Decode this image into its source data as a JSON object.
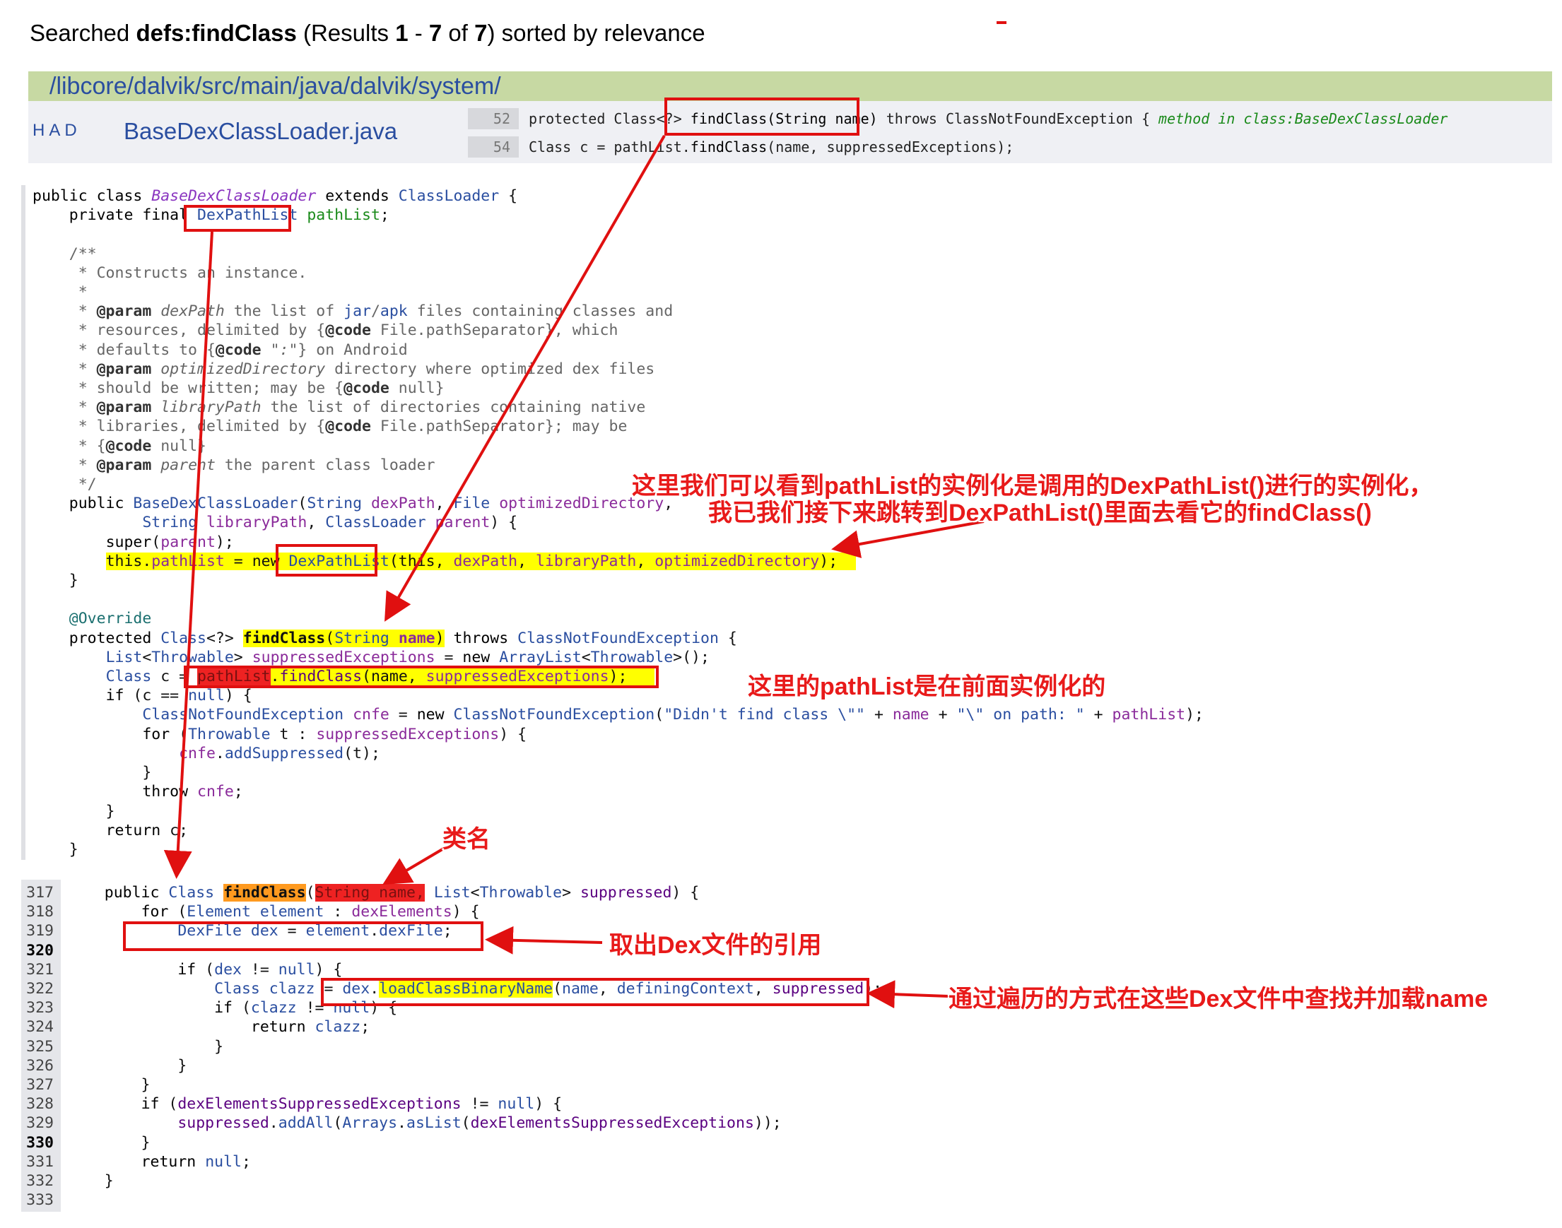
{
  "search_header": {
    "prefix": "Searched ",
    "query": "defs:findClass",
    "results_open": " (Results ",
    "first": "1",
    "dash": " - ",
    "last": "7",
    "of": " of ",
    "total": "7",
    "suffix": ") sorted by relevance"
  },
  "path_bar": {
    "path": "/libcore/dalvik/src/main/java/dalvik/system/"
  },
  "result": {
    "file_actions": "HAD",
    "file_name": "BaseDexClassLoader.java",
    "lines": [
      {
        "num": "52",
        "pre": "protected Class<?> ",
        "hit": "findClass(String name)",
        "post": " throws ClassNotFoundException { ",
        "note": "method in class:BaseDexClassLoader"
      },
      {
        "num": "54",
        "pre": "Class c = pathList.",
        "hit": "findClass",
        "post": "(name, suppressedExceptions);",
        "note": ""
      }
    ]
  },
  "colors": {
    "annotation_red": "#e01010",
    "highlight_yellow": "#ffff00",
    "path_bar_green": "#c7d9a3",
    "link_blue": "#2a4ea0"
  },
  "annotations": {
    "note1_line1": "这里我们可以看到pathList的实例化是调用的DexPathList()进行的实例化，",
    "note1_line2": "我已我们接下来跳转到DexPathList()里面去看它的findClass()",
    "note2": "这里的pathList是在前面实例化的",
    "note3": "类名",
    "note4": "取出Dex文件的引用",
    "note5": "通过遍历的方式在这些Dex文件中查找并加载name"
  },
  "code2_line_numbers": [
    "317",
    "318",
    "319",
    "320",
    "321",
    "322",
    "323",
    "324",
    "325",
    "326",
    "327",
    "328",
    "329",
    "330",
    "331",
    "332",
    "333"
  ]
}
